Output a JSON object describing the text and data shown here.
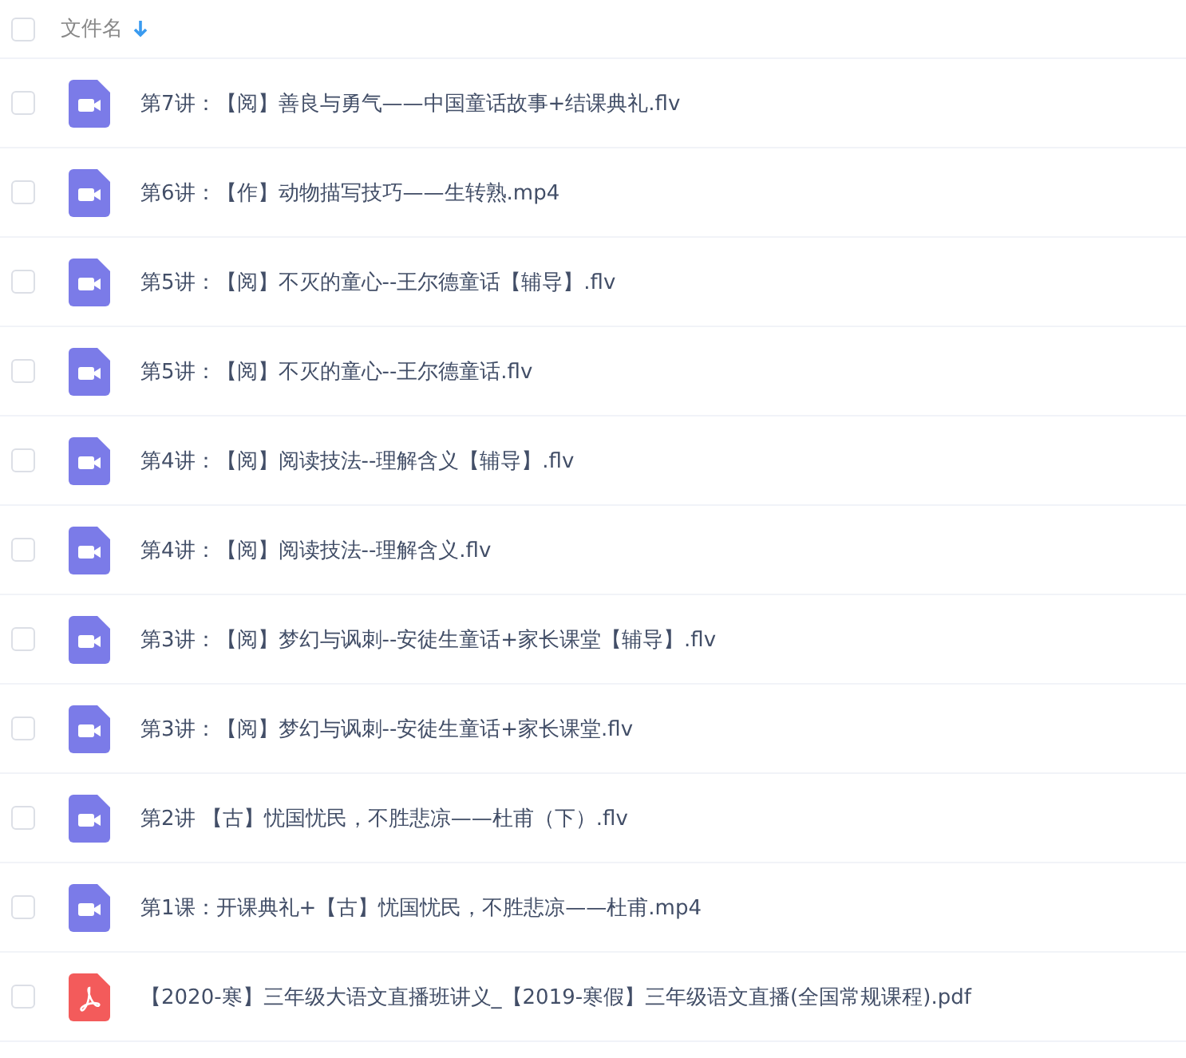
{
  "header": {
    "label": "文件名",
    "checked": false
  },
  "files": [
    {
      "kind": "video",
      "name": "第7讲：【阅】善良与勇气——中国童话故事+结课典礼.flv",
      "checked": false
    },
    {
      "kind": "video",
      "name": "第6讲：【作】动物描写技巧——生转熟.mp4",
      "checked": false
    },
    {
      "kind": "video",
      "name": "第5讲：【阅】不灭的童心--王尔德童话【辅导】.flv",
      "checked": false
    },
    {
      "kind": "video",
      "name": "第5讲：【阅】不灭的童心--王尔德童话.flv",
      "checked": false
    },
    {
      "kind": "video",
      "name": "第4讲：【阅】阅读技法--理解含义【辅导】.flv",
      "checked": false
    },
    {
      "kind": "video",
      "name": "第4讲：【阅】阅读技法--理解含义.flv",
      "checked": false
    },
    {
      "kind": "video",
      "name": "第3讲：【阅】梦幻与讽刺--安徒生童话+家长课堂【辅导】.flv",
      "checked": false
    },
    {
      "kind": "video",
      "name": "第3讲：【阅】梦幻与讽刺--安徒生童话+家长课堂.flv",
      "checked": false
    },
    {
      "kind": "video",
      "name": "第2讲 【古】忧国忧民，不胜悲凉——杜甫（下）.flv",
      "checked": false
    },
    {
      "kind": "video",
      "name": "第1课：开课典礼+【古】忧国忧民，不胜悲凉——杜甫.mp4",
      "checked": false
    },
    {
      "kind": "pdf",
      "name": "【2020-寒】三年级大语文直播班讲义_【2019-寒假】三年级语文直播(全国常规课程).pdf",
      "checked": false
    }
  ]
}
